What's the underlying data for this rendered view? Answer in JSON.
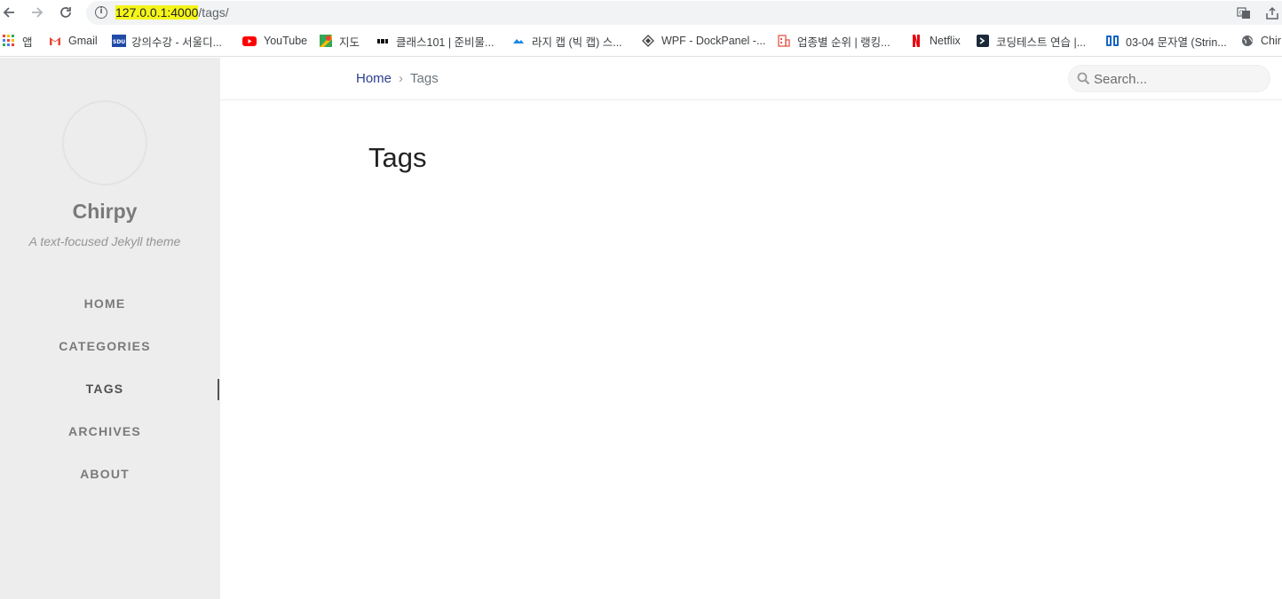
{
  "browser": {
    "url_highlight": "127.0.0.1:4000",
    "url_path": "/tags/",
    "bookmarks": [
      {
        "label": "앱",
        "icon": "apps-grid-icon"
      },
      {
        "label": "Gmail",
        "icon": "gmail-icon"
      },
      {
        "label": "강의수강 - 서울디...",
        "icon": "sdu-icon"
      },
      {
        "label": "YouTube",
        "icon": "youtube-icon"
      },
      {
        "label": "지도",
        "icon": "maps-icon"
      },
      {
        "label": "클래스101 | 준비물...",
        "icon": "class101-icon"
      },
      {
        "label": "라지 캡 (빅 캡) 스...",
        "icon": "cloud-icon"
      },
      {
        "label": "WPF - DockPanel -...",
        "icon": "wpf-icon"
      },
      {
        "label": "업종별 순위 | 랭킹...",
        "icon": "building-icon"
      },
      {
        "label": "Netflix",
        "icon": "netflix-icon"
      },
      {
        "label": "코딩테스트 연습 |...",
        "icon": "programmers-icon"
      },
      {
        "label": "03-04 문자열 (Strin...",
        "icon": "wikidocs-icon"
      },
      {
        "label": "Chir",
        "icon": "globe-icon"
      }
    ],
    "colors": {
      "url_highlight": "#f5f51a",
      "omnibox": "#f1f3f4"
    }
  },
  "sidebar": {
    "title": "Chirpy",
    "subtitle": "A text-focused Jekyll theme",
    "nav": [
      "HOME",
      "CATEGORIES",
      "TAGS",
      "ARCHIVES",
      "ABOUT"
    ],
    "active_item": "TAGS"
  },
  "topbar": {
    "breadcrumb_home": "Home",
    "breadcrumb_separator": "›",
    "breadcrumb_current": "Tags",
    "search_placeholder": "Search..."
  },
  "main": {
    "page_title": "Tags"
  },
  "colors": {
    "sidebar_bg": "#ededed",
    "link": "#2a408e"
  }
}
